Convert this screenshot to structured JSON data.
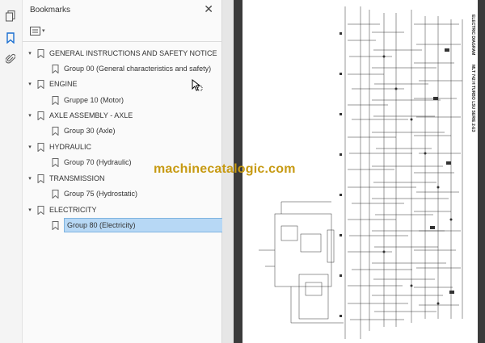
{
  "bookmarks_panel": {
    "title": "Bookmarks",
    "close_glyph": "✕",
    "options_caret": "▾",
    "items": [
      {
        "label": "GENERAL INSTRUCTIONS AND SAFETY NOTICE",
        "level": 0,
        "expanded": true
      },
      {
        "label": "Group 00 (General characteristics and safety)",
        "level": 1
      },
      {
        "label": "ENGINE",
        "level": 0,
        "expanded": true
      },
      {
        "label": "Gruppe 10 (Motor)",
        "level": 1
      },
      {
        "label": "AXLE ASSEMBLY - AXLE",
        "level": 0,
        "expanded": true
      },
      {
        "label": "Group 30 (Axle)",
        "level": 1
      },
      {
        "label": "HYDRAULIC",
        "level": 0,
        "expanded": true
      },
      {
        "label": "Group 70 (Hydraulic)",
        "level": 1
      },
      {
        "label": "TRANSMISSION",
        "level": 0,
        "expanded": true
      },
      {
        "label": "Group 75 (Hydrostatic)",
        "level": 1
      },
      {
        "label": "ELECTRICITY",
        "level": 0,
        "expanded": true
      },
      {
        "label": "Group 80 (Electricity)",
        "level": 1,
        "selected": true
      }
    ]
  },
  "left_rail": {
    "icons": [
      "pages-icon",
      "bookmark-icon",
      "attachment-icon"
    ]
  },
  "document": {
    "watermark": "machinecatalogic.com",
    "page_side_text": [
      "ELECTRIC DIAGRAM",
      "MLT 742 H TURBO LSU SERIE 2-E3"
    ]
  },
  "colors": {
    "selection_fill": "#b7d8f5",
    "selection_border": "#7fb4e0",
    "watermark": "#c79a12",
    "canvas_bg": "#3b3b3b"
  }
}
